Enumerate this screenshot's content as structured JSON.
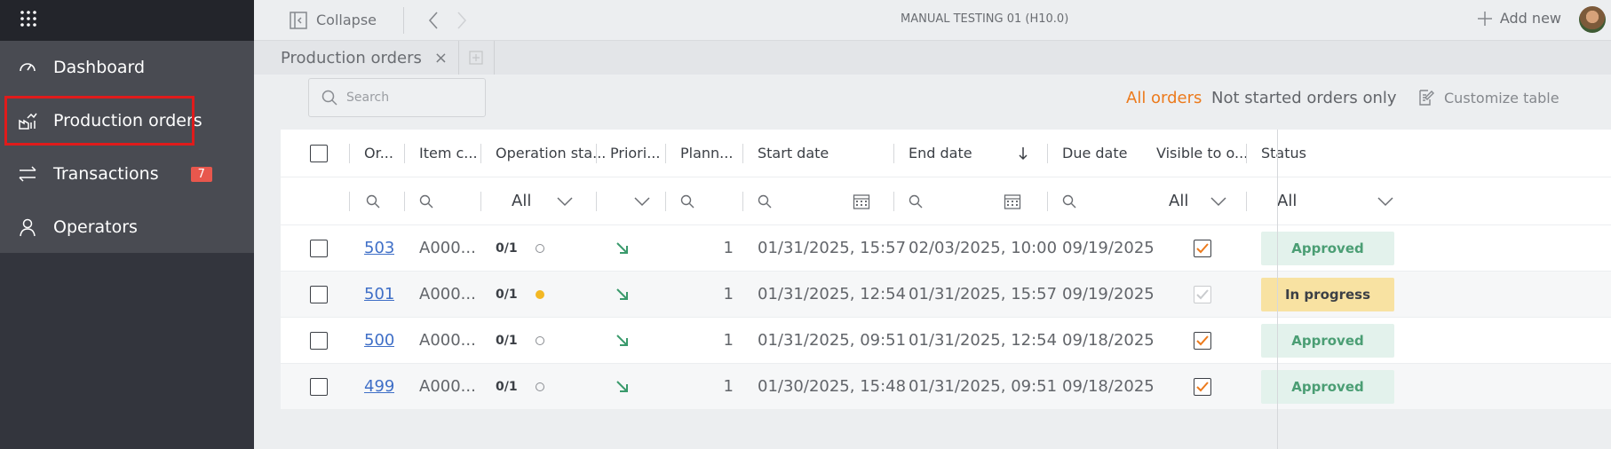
{
  "sidebar": {
    "items": [
      {
        "label": "Dashboard"
      },
      {
        "label": "Production orders"
      },
      {
        "label": "Transactions",
        "badge": "7"
      },
      {
        "label": "Operators"
      }
    ]
  },
  "topbar": {
    "collapse_label": "Collapse",
    "title": "MANUAL TESTING 01 (H10.0)",
    "add_new_label": "Add new"
  },
  "tabs": [
    {
      "label": "Production orders"
    }
  ],
  "toolbar": {
    "search_placeholder": "Search",
    "all_orders": "All orders",
    "not_started": "Not started orders only",
    "customize": "Customize table"
  },
  "table": {
    "columns": {
      "order": "Or...",
      "item": "Item c...",
      "opstatus": "Operation sta...",
      "priority": "Priori...",
      "planned": "Plann...",
      "start": "Start date",
      "end": "End date",
      "due": "Due date",
      "visible": "Visible to o...",
      "status": "Status"
    },
    "filters": {
      "opstatus": "All",
      "visible": "All",
      "status": "All"
    },
    "rows": [
      {
        "order": "503",
        "item": "A000...",
        "op": "0/1",
        "planned": "1",
        "start": "01/31/2025, 15:57",
        "end": "02/03/2025, 10:00",
        "due": "09/19/2025",
        "status": "Approved"
      },
      {
        "order": "501",
        "item": "A000...",
        "op": "0/1",
        "planned": "1",
        "start": "01/31/2025, 12:54",
        "end": "01/31/2025, 15:57",
        "due": "09/19/2025",
        "status": "In progress"
      },
      {
        "order": "500",
        "item": "A000...",
        "op": "0/1",
        "planned": "1",
        "start": "01/31/2025, 09:51",
        "end": "01/31/2025, 12:54",
        "due": "09/18/2025",
        "status": "Approved"
      },
      {
        "order": "499",
        "item": "A000...",
        "op": "0/1",
        "planned": "1",
        "start": "01/30/2025, 15:48",
        "end": "01/31/2025, 09:51",
        "due": "09/18/2025",
        "status": "Approved"
      }
    ]
  },
  "colors": {
    "accent": "#ec7a1c",
    "highlight": "#e01b1b",
    "link": "#3f6fc7"
  }
}
